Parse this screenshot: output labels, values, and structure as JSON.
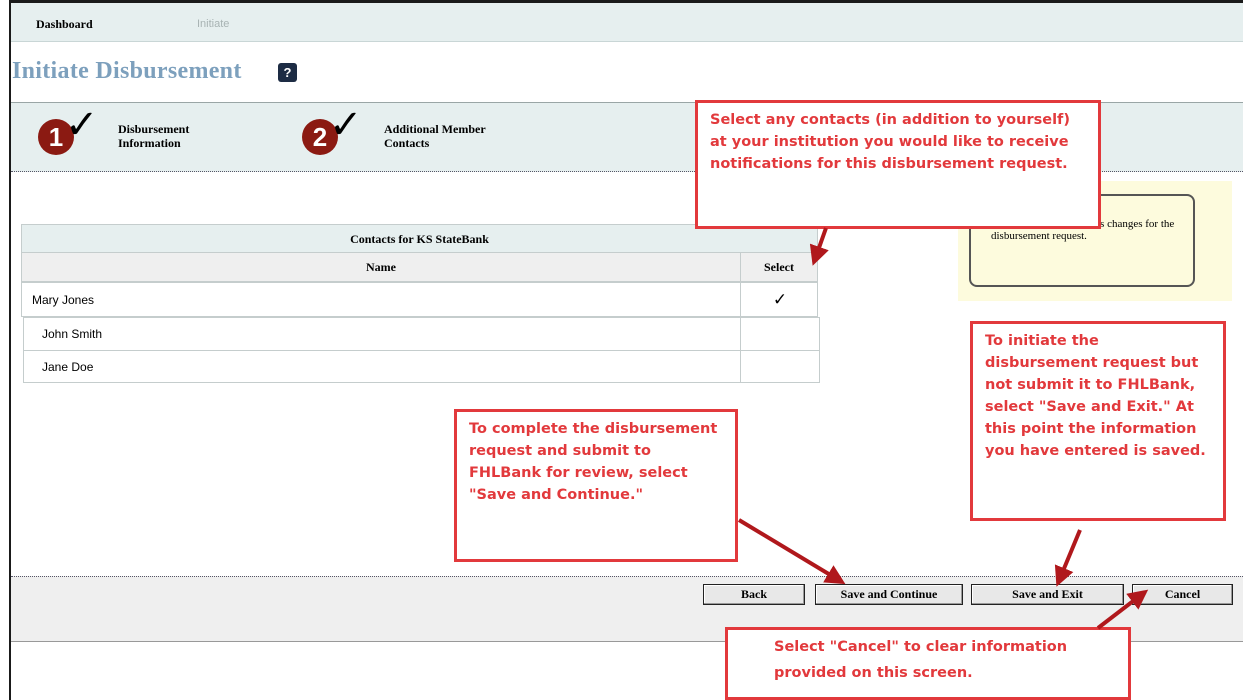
{
  "nav": {
    "dashboard": "Dashboard",
    "initiate": "Initiate"
  },
  "page": {
    "title": "Initiate Disbursement",
    "help_icon": "?"
  },
  "steps": [
    {
      "number": "1",
      "label": "Disbursement Information",
      "status_icon": "checkmark-icon"
    },
    {
      "number": "2",
      "label": "Additional Member Contacts",
      "status_icon": "checkmark-icon"
    }
  ],
  "contacts": {
    "title": "Contacts for KS StateBank",
    "columns": {
      "name": "Name",
      "select": "Select"
    },
    "rows": [
      {
        "name": "Mary Jones",
        "selected": "✓"
      },
      {
        "name": "John Smith",
        "selected": ""
      },
      {
        "name": "Jane Doe",
        "selected": ""
      }
    ]
  },
  "info_box": {
    "text": "who should receive status changes for the disbursement request."
  },
  "buttons": {
    "back": "Back",
    "save_continue": "Save and Continue",
    "save_exit": "Save and Exit",
    "cancel": "Cancel"
  },
  "callouts": {
    "select_contacts": "Select any contacts (in addition to yourself) at your institution you would like to receive notifications for this disbursement request.",
    "save_continue": "To complete the disbursement request and submit to FHLBank for review, select \"Save and Continue.\"",
    "save_exit": "To initiate the disbursement request but not submit it to FHLBank, select \"Save and Exit.\" At this point the information you have entered is saved.",
    "cancel": "Select \"Cancel\" to clear information provided on this screen."
  },
  "colors": {
    "callout": "#e2393c",
    "arrow": "#b0181c",
    "step_circle": "#8b1a12",
    "title": "#7da0bd",
    "band": "#e6efef"
  }
}
